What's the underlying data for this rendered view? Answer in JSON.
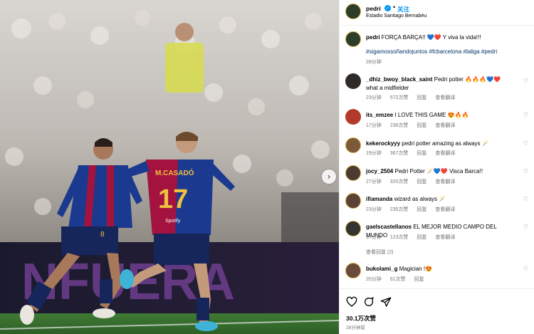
{
  "post": {
    "username": "pedri",
    "dot": "•",
    "follow_label": "关注",
    "location": "Estadio Santiago Bernabéu",
    "caption_text": "FORÇA BARÇA!! 💙❤️ Y viva la vida!!!",
    "hashtags": "#sigamossoñandojuntos #fcbarcelona #laliga #pedri",
    "caption_time": "28分钟",
    "likes": "30.1万次赞",
    "time": "28分钟前"
  },
  "photo": {
    "player_left_number": "8",
    "player_right_name": "M.CASADÓ",
    "player_right_number": "17",
    "banner_text": "NFUERA",
    "sponsor": "Spotify"
  },
  "comments": [
    {
      "username": "_dhiz_bwoy_black_saint",
      "text": "Pedri potter 🔥🔥🔥💙❤️ what a midfielder",
      "time": "23分钟",
      "likes": "572次赞",
      "reply": "回复",
      "translate": "查看翻译"
    },
    {
      "username": "its_emzee",
      "text": "I LOVE THIS GAME 😍🔥🔥",
      "time": "17分钟",
      "likes": "236次赞",
      "reply": "回复",
      "translate": "查看翻译"
    },
    {
      "username": "kekerockyyy",
      "text": "pedri potter amazing as always 🪄",
      "time": "19分钟",
      "likes": "367次赞",
      "reply": "回复",
      "translate": "查看翻译"
    },
    {
      "username": "jocy_2504",
      "text": "Pedri Potter 🪄💙❤️ Visca Barca!!",
      "time": "27分钟",
      "likes": "320次赞",
      "reply": "回复",
      "translate": "查看翻译"
    },
    {
      "username": "ifiamanda",
      "text": "wizard as always 🪄",
      "time": "23分钟",
      "likes": "235次赞",
      "reply": "回复",
      "translate": "查看翻译"
    },
    {
      "username": "gaelscastellanos",
      "text": "EL MEJOR MEDIO CAMPO DEL MUNDO",
      "time": "17分钟",
      "likes": "123次赞",
      "reply": "回复",
      "translate": "查看翻译",
      "view_replies": "查看回复 (2)"
    },
    {
      "username": "bukolami_g",
      "text": "Magician !😍",
      "time": "20分钟",
      "likes": "61次赞",
      "reply": "回复",
      "translate": ""
    }
  ],
  "colors": {
    "accent_blue": "#0095f6",
    "hashtag": "#00376b",
    "muted": "#737373",
    "barca_blue": "#1b3a8f",
    "barca_red": "#a4123f"
  },
  "icons": [
    "heart-icon",
    "comment-icon",
    "share-icon",
    "verified-icon",
    "next-arrow-icon"
  ]
}
